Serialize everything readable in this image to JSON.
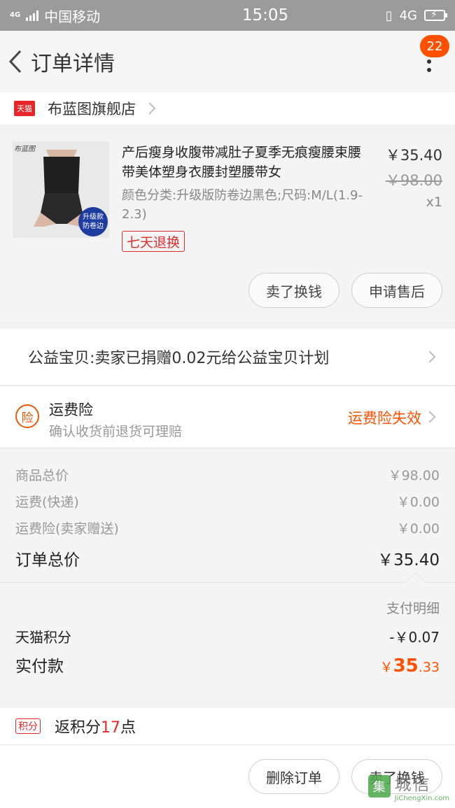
{
  "status_bar": {
    "network_label": "4G",
    "carrier": "中国移动",
    "time": "15:05",
    "network_right": "4G"
  },
  "header": {
    "title": "订单详情",
    "notification_count": "22"
  },
  "store": {
    "platform_badge": "天猫",
    "name": "布蓝图旗舰店"
  },
  "product": {
    "image_brand": "布蓝图",
    "image_tag": "升级款 防卷边",
    "title": "产后瘦身收腹带减肚子夏季无痕瘦腰束腰带美体塑身衣腰封塑腰带女",
    "attributes": "颜色分类:升级版防卷边黑色;尺码:M/L(1.9-2.3)",
    "return_policy": "七天退换",
    "price": "￥35.40",
    "original_price": "￥98.00",
    "quantity": "x1",
    "buttons": [
      "卖了换钱",
      "申请售后"
    ]
  },
  "charity": {
    "text": "公益宝贝:卖家已捐赠0.02元给公益宝贝计划"
  },
  "shipping_insurance": {
    "icon_text": "险",
    "title": "运费险",
    "subtitle": "确认收货前退货可理赔",
    "status": "运费险失效"
  },
  "summary": {
    "rows": [
      {
        "label": "商品总价",
        "value": "￥98.00"
      },
      {
        "label": "运费(快递)",
        "value": "￥0.00"
      },
      {
        "label": "运费险(卖家赠送)",
        "value": "￥0.00"
      }
    ],
    "total_label": "订单总价",
    "total_value": "￥35.40"
  },
  "payment": {
    "detail_link": "支付明细",
    "points_label": "天猫积分",
    "points_value": "-￥0.07",
    "paid_label": "实付款",
    "paid_currency": "￥",
    "paid_integer": "35",
    "paid_decimal": ".33"
  },
  "points": {
    "tag": "积分",
    "prefix": "返积分",
    "count": "17",
    "suffix": "点"
  },
  "bottom_bar": {
    "delete_label": "删除订单",
    "sell_label": "卖了换钱"
  },
  "watermark": {
    "logo": "集",
    "cn": "城信",
    "en": "JiChengXin.com"
  },
  "colors": {
    "accent": "#ff5000",
    "tmall_red": "#e7262b",
    "status_bar": "#9b9b9b"
  }
}
